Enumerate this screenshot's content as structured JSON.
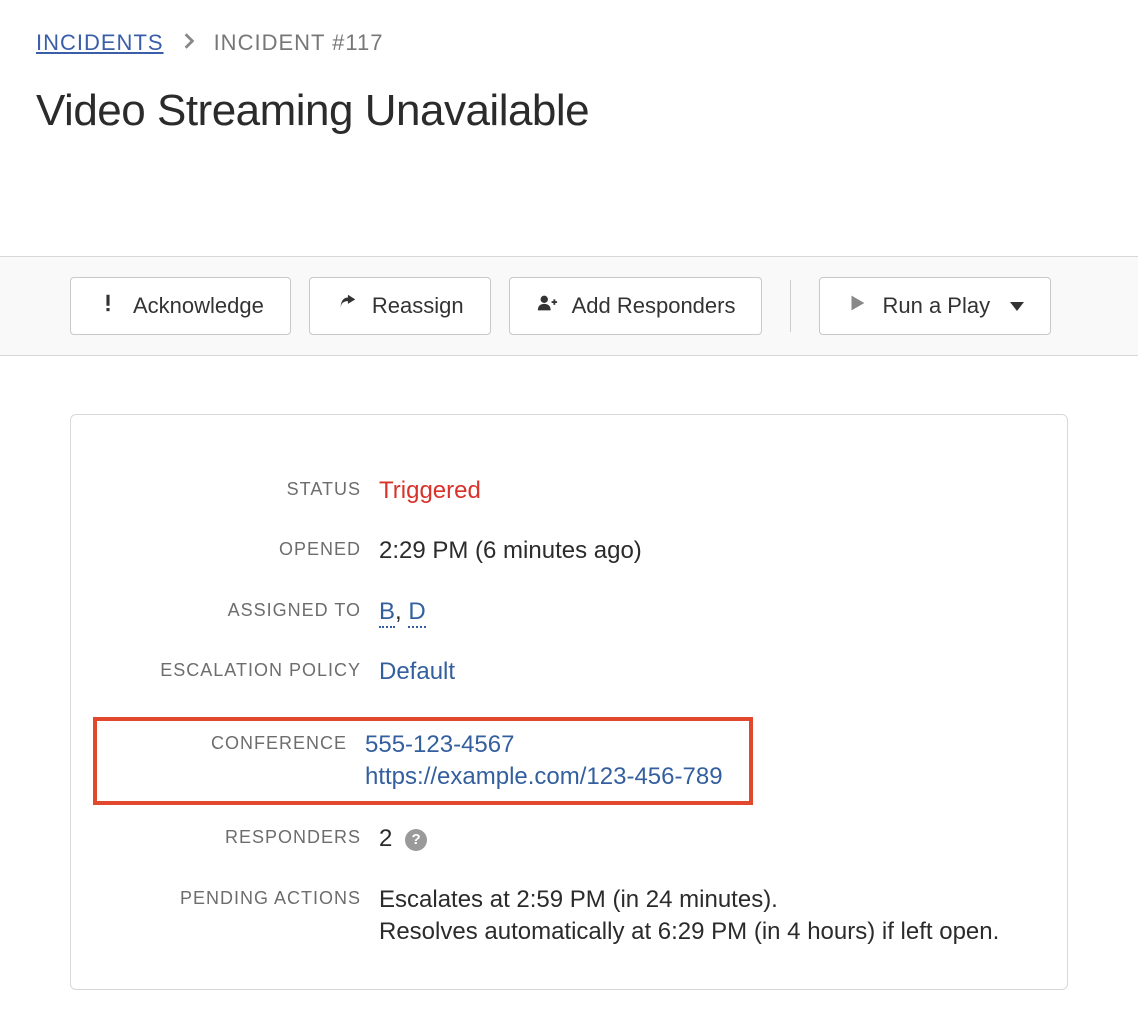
{
  "breadcrumb": {
    "root": "INCIDENTS",
    "current": "INCIDENT #117"
  },
  "page_title": "Video Streaming Unavailable",
  "toolbar": {
    "acknowledge_label": "Acknowledge",
    "reassign_label": "Reassign",
    "add_responders_label": "Add Responders",
    "run_play_label": "Run a Play"
  },
  "labels": {
    "status": "STATUS",
    "opened": "OPENED",
    "assigned_to": "ASSIGNED TO",
    "escalation_policy": "ESCALATION POLICY",
    "conference": "CONFERENCE",
    "responders": "RESPONDERS",
    "pending_actions": "PENDING ACTIONS"
  },
  "details": {
    "status": "Triggered",
    "opened": "2:29 PM (6 minutes ago)",
    "assigned_to": {
      "a": "B",
      "sep": ", ",
      "b": "D"
    },
    "escalation_policy": "Default",
    "conference_phone": "555-123-4567",
    "conference_url": "https://example.com/123-456-789",
    "responders_count": "2",
    "pending_actions_line1": "Escalates at 2:59 PM (in 24 minutes).",
    "pending_actions_line2": "Resolves automatically at 6:29 PM (in 4 hours) if left open."
  }
}
